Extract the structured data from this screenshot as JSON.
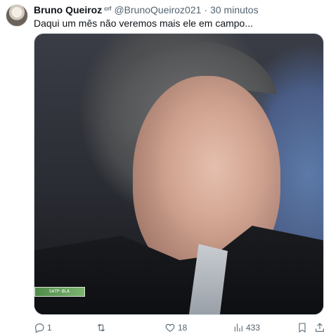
{
  "tweet": {
    "author_name": "Bruno Queiroz",
    "author_badge": "crf",
    "handle": "@BrunoQueiroz021",
    "separator": "·",
    "time": "30 minutos",
    "text": "Daqui um mês não veremos mais ele em campo..."
  },
  "media": {
    "overlay_text": "SATP·BLA"
  },
  "actions": {
    "replies": "1",
    "retweets": "",
    "likes": "18",
    "views": "433"
  },
  "icons": {
    "reply": "reply-icon",
    "retweet": "retweet-icon",
    "like": "heart-icon",
    "views": "views-icon",
    "bookmark": "bookmark-icon",
    "share": "share-icon"
  }
}
